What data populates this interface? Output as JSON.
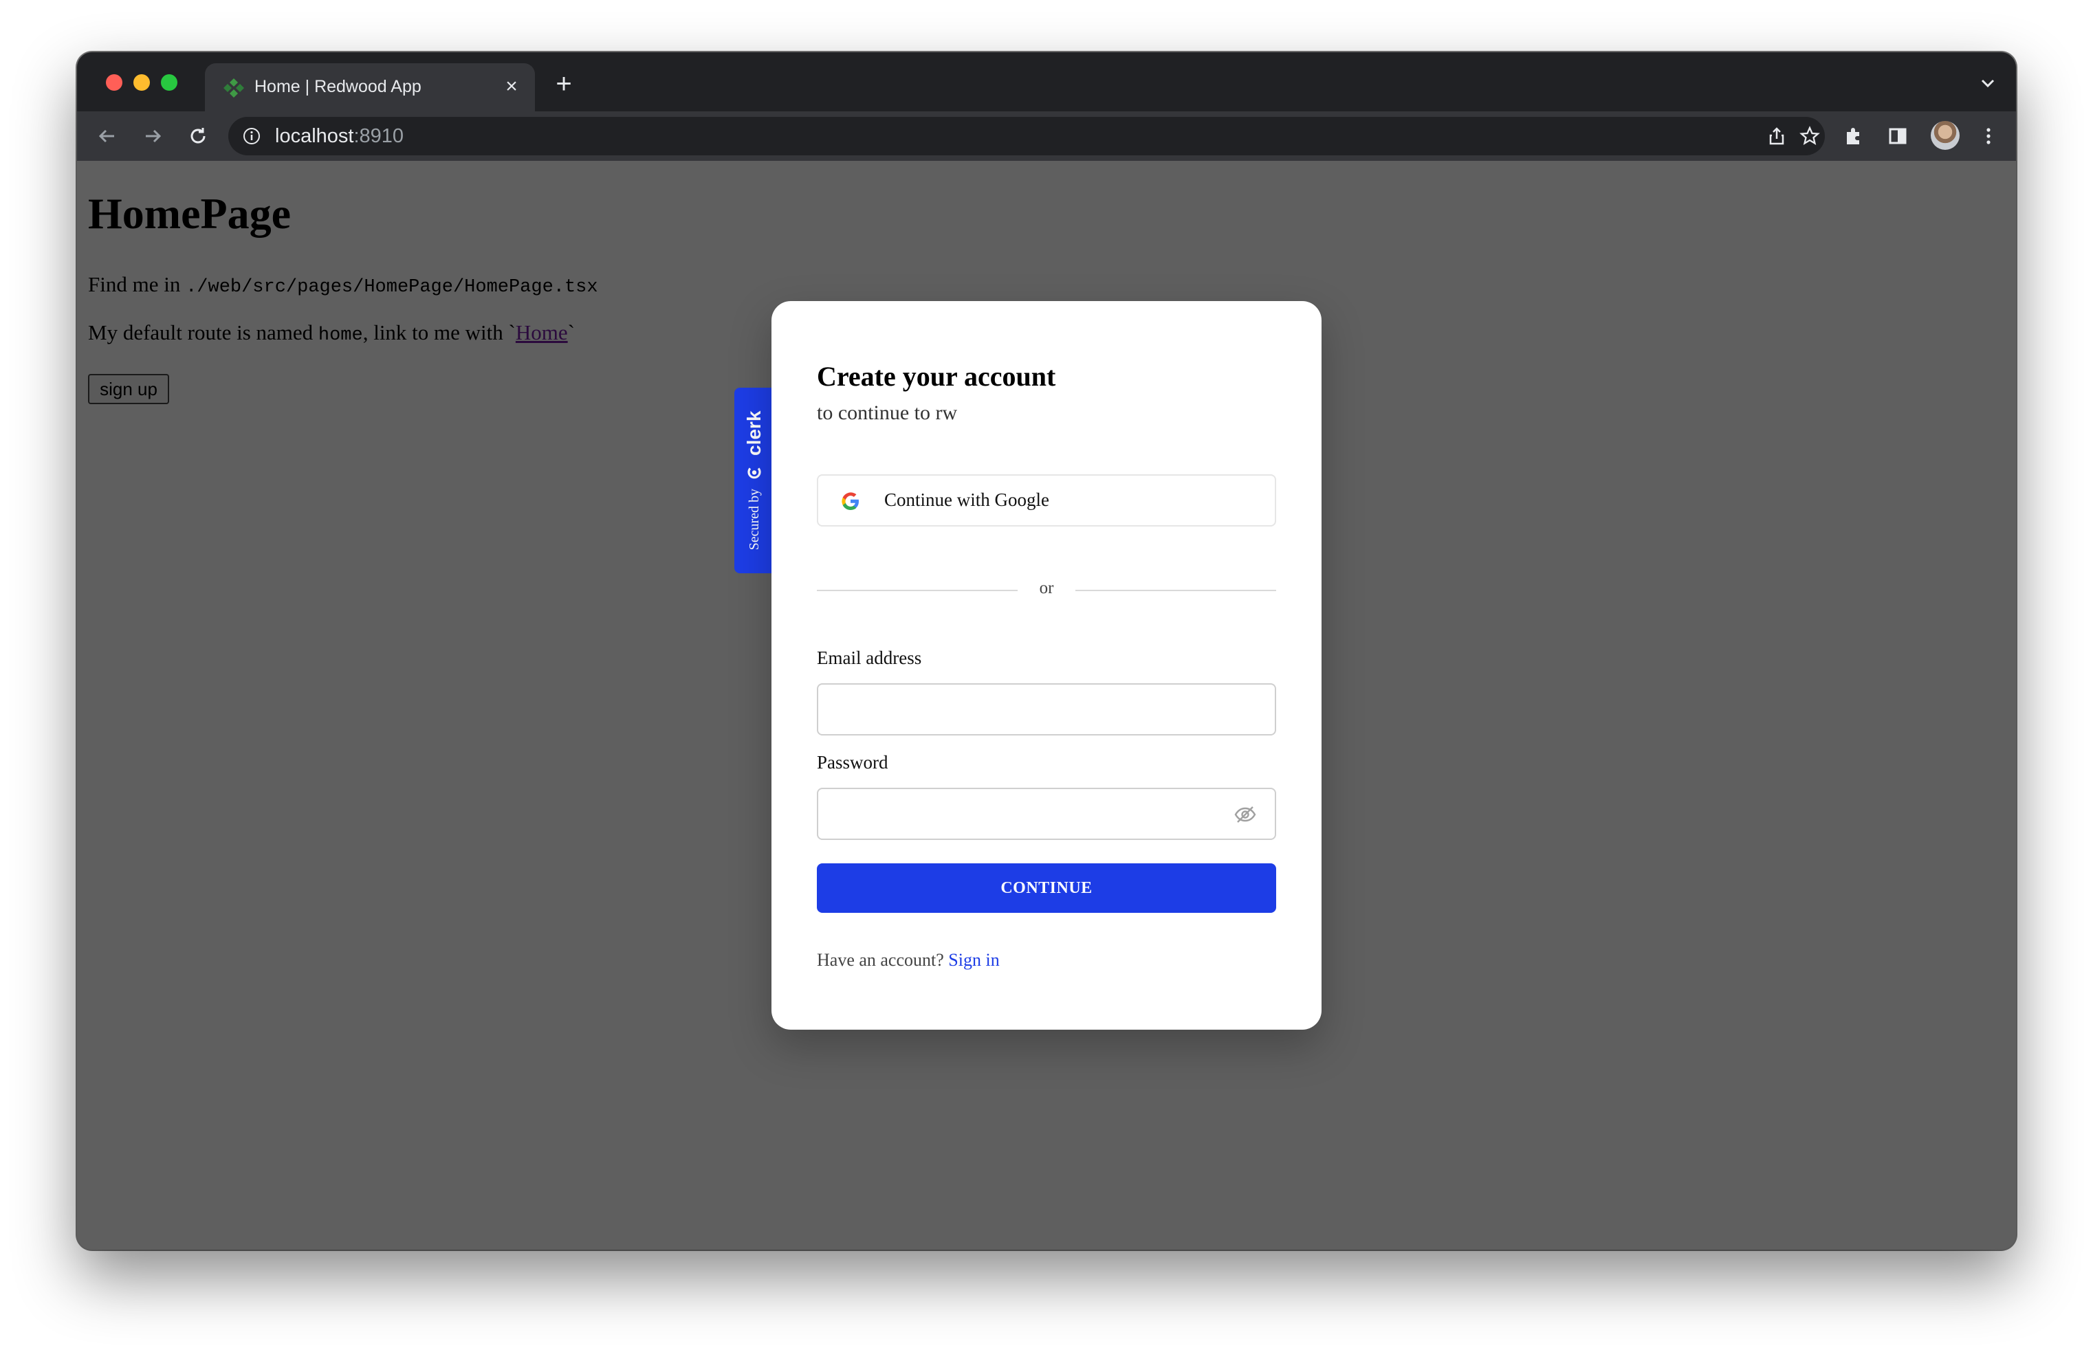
{
  "browser": {
    "tab_title": "Home | Redwood App",
    "url_host": "localhost",
    "url_port": ":8910"
  },
  "page": {
    "heading": "HomePage",
    "find_prefix": "Find me in ",
    "find_path": "./web/src/pages/HomePage/HomePage.tsx",
    "route_prefix": "My default route is named ",
    "route_name": "home",
    "route_middle": ", link to me with `",
    "route_link": "Home",
    "route_suffix": "`",
    "signup_button": "sign up"
  },
  "clerk_badge": {
    "secured_by": "Secured by",
    "brand": "clerk"
  },
  "modal": {
    "title": "Create your account",
    "subtitle": "to continue to rw",
    "google_button": "Continue with Google",
    "divider": "or",
    "email_label": "Email address",
    "email_value": "",
    "password_label": "Password",
    "password_value": "",
    "continue_button": "CONTINUE",
    "footer_prefix": "Have an account? ",
    "footer_link": "Sign in"
  },
  "colors": {
    "accent": "#1d3de6",
    "overlay": "#5f5f5f"
  }
}
